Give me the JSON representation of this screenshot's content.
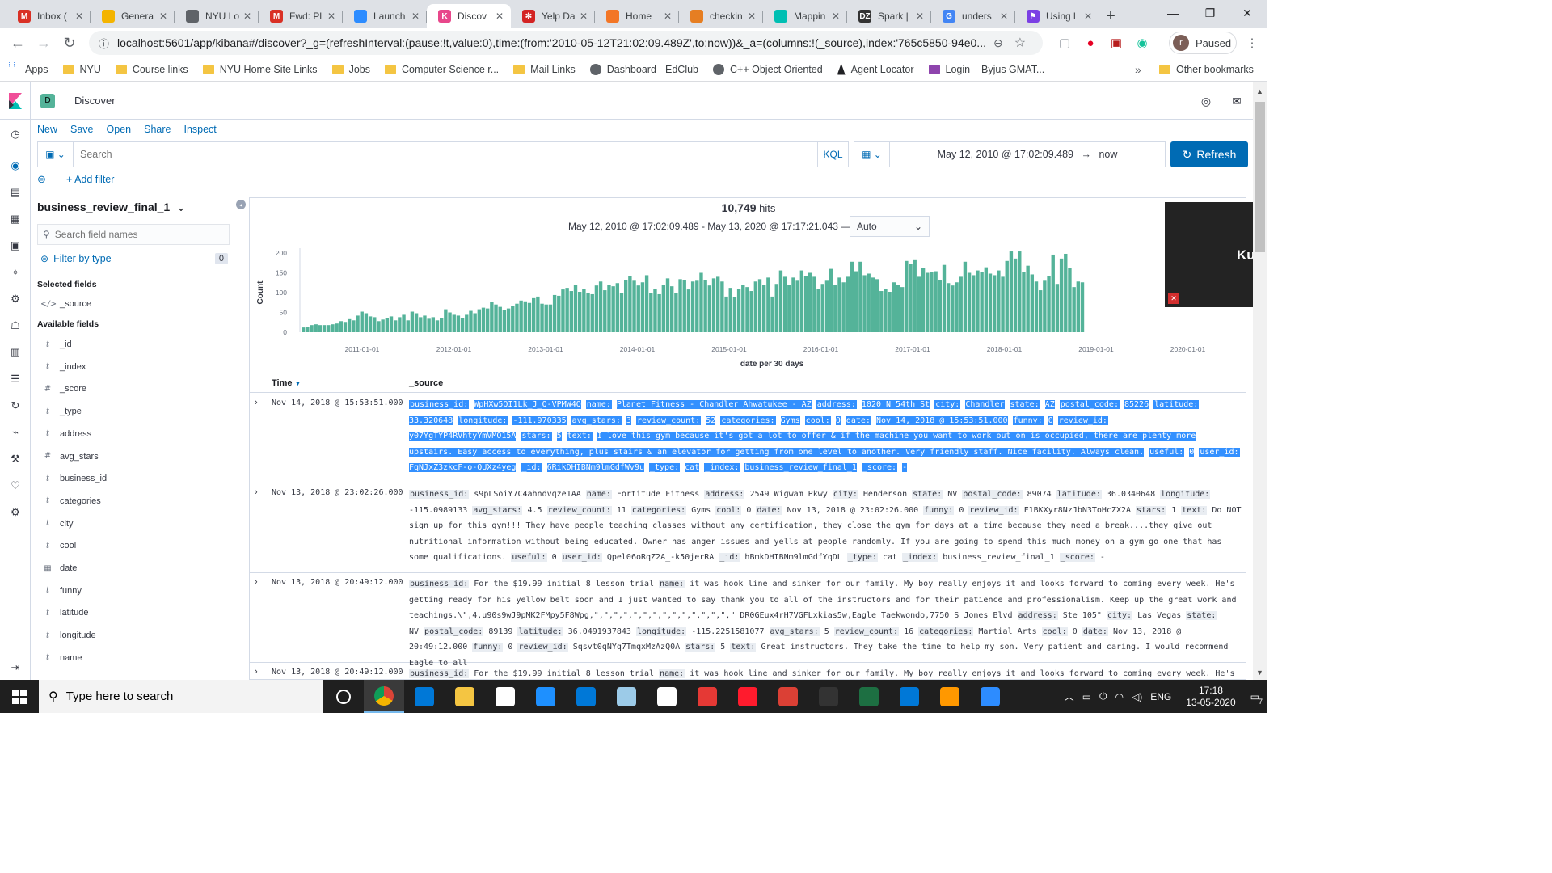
{
  "browser": {
    "tabs": [
      {
        "label": "Inbox (",
        "icon": "gmail-icon",
        "color": "#d93025",
        "glyph": "M"
      },
      {
        "label": "Genera",
        "icon": "slides-icon",
        "color": "#f4b400",
        "glyph": ""
      },
      {
        "label": "NYU Lo",
        "icon": "globe-icon",
        "color": "#5f6368",
        "glyph": ""
      },
      {
        "label": "Fwd: Pl",
        "icon": "gmail-icon",
        "color": "#d93025",
        "glyph": "M"
      },
      {
        "label": "Launch",
        "icon": "zoom-icon",
        "color": "#2d8cff",
        "glyph": ""
      },
      {
        "label": "Discov",
        "icon": "kibana-icon",
        "color": "#e8478b",
        "glyph": "K"
      },
      {
        "label": "Yelp Da",
        "icon": "yelp-icon",
        "color": "#d32323",
        "glyph": "✻"
      },
      {
        "label": "Home",
        "icon": "jupyter-icon",
        "color": "#f37626",
        "glyph": ""
      },
      {
        "label": "checkin",
        "icon": "notebook-icon",
        "color": "#e67e22",
        "glyph": ""
      },
      {
        "label": "Mappin",
        "icon": "elastic-icon",
        "color": "#00bfb3",
        "glyph": ""
      },
      {
        "label": "Spark |",
        "icon": "dzone-icon",
        "color": "#333333",
        "glyph": "DZ"
      },
      {
        "label": "unders",
        "icon": "google-icon",
        "color": "#4285f4",
        "glyph": "G"
      },
      {
        "label": "Using l",
        "icon": "flag-icon",
        "color": "#7b3fe4",
        "glyph": "⚑"
      }
    ],
    "active_tab_index": 5,
    "url": "localhost:5601/app/kibana#/discover?_g=(refreshInterval:(pause:!t,value:0),time:(from:'2010-05-12T21:02:09.489Z',to:now))&_a=(columns:!(_source),index:'765c5850-94e0...",
    "profile_status": "Paused",
    "profile_initial": "r",
    "bookmarks": [
      {
        "label": "Apps",
        "kind": "apps"
      },
      {
        "label": "NYU",
        "kind": "folder"
      },
      {
        "label": "Course links",
        "kind": "folder"
      },
      {
        "label": "NYU Home Site Links",
        "kind": "folder"
      },
      {
        "label": "Jobs",
        "kind": "folder"
      },
      {
        "label": "Computer Science r...",
        "kind": "folder"
      },
      {
        "label": "Mail Links",
        "kind": "folder"
      },
      {
        "label": "Dashboard - EdClub",
        "kind": "dark"
      },
      {
        "label": "C++ Object Oriented",
        "kind": "dark"
      },
      {
        "label": "Agent Locator",
        "kind": "navy"
      },
      {
        "label": "Login – Byjus GMAT...",
        "kind": "purple"
      }
    ],
    "bookmarks_overflow": "»",
    "other_bookmarks": "Other bookmarks"
  },
  "kibana": {
    "app_badge": "D",
    "breadcrumb": "Discover",
    "menu": [
      "New",
      "Save",
      "Open",
      "Share",
      "Inspect"
    ],
    "search_placeholder": "Search",
    "query_language": "KQL",
    "date_range": "May 12, 2010 @ 17:02:09.489",
    "date_to": "now",
    "refresh_label": "Refresh",
    "add_filter": "+ Add filter",
    "index_pattern": "business_review_final_1",
    "field_search_placeholder": "Search field names",
    "filter_by_type": "Filter by type",
    "filter_count": "0",
    "selected_fields_title": "Selected fields",
    "selected_fields": [
      {
        "type": "</>",
        "name": "_source"
      }
    ],
    "available_fields_title": "Available fields",
    "available_fields": [
      {
        "type": "t",
        "name": "_id"
      },
      {
        "type": "t",
        "name": "_index"
      },
      {
        "type": "#",
        "name": "_score"
      },
      {
        "type": "t",
        "name": "_type"
      },
      {
        "type": "t",
        "name": "address"
      },
      {
        "type": "#",
        "name": "avg_stars"
      },
      {
        "type": "t",
        "name": "business_id"
      },
      {
        "type": "t",
        "name": "categories"
      },
      {
        "type": "t",
        "name": "city"
      },
      {
        "type": "t",
        "name": "cool"
      },
      {
        "type": "▦",
        "name": "date"
      },
      {
        "type": "t",
        "name": "funny"
      },
      {
        "type": "t",
        "name": "latitude"
      },
      {
        "type": "t",
        "name": "longitude"
      },
      {
        "type": "t",
        "name": "name"
      }
    ],
    "hits_count": "10,749",
    "hits_label": "hits",
    "time_range_text": "May 12, 2010 @ 17:02:09.489 - May 13, 2020 @ 17:17:21.043 —",
    "interval": "Auto",
    "table_headers": {
      "time": "Time",
      "source": "_source"
    },
    "docs": [
      {
        "time": "Nov 14, 2018 @ 15:53:51.000",
        "selected": true,
        "fields": [
          [
            "business_id:",
            "WpHXw5QI1Lk_J_Q-VPMW4Q"
          ],
          [
            "name:",
            "Planet Fitness - Chandler Ahwatukee - AZ"
          ],
          [
            "address:",
            "1020 N 54th St"
          ],
          [
            "city:",
            "Chandler"
          ],
          [
            "state:",
            "AZ"
          ],
          [
            "postal_code:",
            "85226"
          ],
          [
            "latitude:",
            "33.320648"
          ],
          [
            "longitude:",
            "-111.970335"
          ],
          [
            "avg_stars:",
            "3"
          ],
          [
            "review_count:",
            "52"
          ],
          [
            "categories:",
            "Gyms"
          ],
          [
            "cool:",
            "0"
          ],
          [
            "date:",
            "Nov 14, 2018 @ 15:53:51.000"
          ],
          [
            "funny:",
            "0"
          ],
          [
            "review_id:",
            "y07YgTYP4RVhtyYmVMO15A"
          ],
          [
            "stars:",
            "5"
          ],
          [
            "text:",
            "I love this gym because it's got a lot to offer & if the machine you want to work out on is occupied, there are plenty more upstairs. Easy access to everything, plus stairs & an elevator for getting from one level to another. Very friendly staff. Nice facility. Always clean."
          ],
          [
            "useful:",
            "0"
          ],
          [
            "user_id:",
            "FqNJxZ3zkcF-o-QUXz4yeg"
          ],
          [
            "_id:",
            "6RikDHIBNm9lmGdfWv9u"
          ],
          [
            "_type:",
            "cat"
          ],
          [
            "_index:",
            "business_review_final_1"
          ],
          [
            "_score:",
            " -"
          ]
        ]
      },
      {
        "time": "Nov 13, 2018 @ 23:02:26.000",
        "selected": false,
        "fields": [
          [
            "business_id:",
            "s9pLSoiY7C4ahndvqze1AA"
          ],
          [
            "name:",
            "Fortitude Fitness"
          ],
          [
            "address:",
            "2549 Wigwam Pkwy"
          ],
          [
            "city:",
            "Henderson"
          ],
          [
            "state:",
            "NV"
          ],
          [
            "postal_code:",
            "89074"
          ],
          [
            "latitude:",
            "36.0340648"
          ],
          [
            "longitude:",
            "-115.0989133"
          ],
          [
            "avg_stars:",
            "4.5"
          ],
          [
            "review_count:",
            "11"
          ],
          [
            "categories:",
            "Gyms"
          ],
          [
            "cool:",
            "0"
          ],
          [
            "date:",
            "Nov 13, 2018 @ 23:02:26.000"
          ],
          [
            "funny:",
            "0"
          ],
          [
            "review_id:",
            "F1BKXyr8NzJbN3ToHcZX2A"
          ],
          [
            "stars:",
            "1"
          ],
          [
            "text:",
            "Do NOT sign up for this gym!!! They have people teaching classes without any certification, they close the gym for days at a time because they need a break....they give out nutritional information without being educated. Owner has anger issues and yells at people randomly. If you are going to spend this much money on a gym go one that has some qualifications."
          ],
          [
            "useful:",
            "0"
          ],
          [
            "user_id:",
            "Qpel06oRqZ2A_-k50jerRA"
          ],
          [
            "_id:",
            "hBmkDHIBNm9lmGdfYqDL"
          ],
          [
            "_type:",
            "cat"
          ],
          [
            "_index:",
            "business_review_final_1"
          ],
          [
            "_score:",
            " -"
          ]
        ]
      },
      {
        "time": "Nov 13, 2018 @ 20:49:12.000",
        "selected": false,
        "fields": [
          [
            "business_id:",
            "For the $19.99 initial 8 lesson trial"
          ],
          [
            "name:",
            "it was hook line and sinker for our family. My boy really enjoys it and looks forward to coming every week. He's getting ready for his yellow belt soon and I just wanted to say thank you to all of the instructors and for their patience and professionalism. Keep up the great work and teachings.\\\",4,u90s9wJ9pMK2FMpy5F8Wpg,\",\",\",\",\",\",\",\",\",\",\",\",\",\",\" DR0GEux4rH7VGFLxkias5w,Eagle Taekwondo,7750 S Jones Blvd"
          ],
          [
            "address:",
            "Ste 105\""
          ],
          [
            "city:",
            "Las Vegas"
          ],
          [
            "state:",
            "NV"
          ],
          [
            "postal_code:",
            "89139"
          ],
          [
            "latitude:",
            "36.0491937843"
          ],
          [
            "longitude:",
            "-115.2251581077"
          ],
          [
            "avg_stars:",
            "5"
          ],
          [
            "review_count:",
            "16"
          ],
          [
            "categories:",
            "Martial Arts"
          ],
          [
            "cool:",
            "0"
          ],
          [
            "date:",
            "Nov 13, 2018 @ 20:49:12.000"
          ],
          [
            "funny:",
            "0"
          ],
          [
            "review_id:",
            "Sqsvt0qNYq7TmqxMzAzQ0A"
          ],
          [
            "stars:",
            "5"
          ],
          [
            "text:",
            "Great instructors. They take the time to help my son. Very patient and caring. I would recommend Eagle to all"
          ]
        ]
      },
      {
        "time": "Nov 13, 2018 @ 20:49:12.000",
        "selected": false,
        "fields": [
          [
            "business_id:",
            "For the $19.99 initial 8 lesson trial"
          ],
          [
            "name:",
            "it was hook line and sinker for our family. My boy really enjoys it and looks forward to coming every week. He's"
          ]
        ]
      }
    ]
  },
  "chart_data": {
    "type": "bar",
    "title": "",
    "xlabel": "date per 30 days",
    "ylabel": "Count",
    "ylim": [
      0,
      200
    ],
    "yticks": [
      0,
      50,
      100,
      150,
      200
    ],
    "xticks": [
      "2011-01-01",
      "2012-01-01",
      "2013-01-01",
      "2014-01-01",
      "2015-01-01",
      "2016-01-01",
      "2017-01-01",
      "2018-01-01",
      "2019-01-01",
      "2020-01-01"
    ],
    "bar_color": "#54b399",
    "x_start": "2010-05",
    "x_step": "30 days",
    "values": [
      12,
      14,
      18,
      20,
      18,
      18,
      18,
      20,
      22,
      28,
      26,
      33,
      30,
      42,
      52,
      48,
      40,
      38,
      28,
      32,
      36,
      40,
      30,
      38,
      44,
      30,
      52,
      48,
      38,
      42,
      34,
      38,
      30,
      36,
      58,
      50,
      44,
      42,
      36,
      44,
      54,
      48,
      58,
      62,
      60,
      76,
      70,
      64,
      56,
      60,
      66,
      72,
      80,
      78,
      74,
      86,
      90,
      72,
      70,
      70,
      94,
      92,
      108,
      112,
      104,
      120,
      102,
      110,
      100,
      96,
      118,
      128,
      106,
      120,
      116,
      124,
      100,
      132,
      142,
      130,
      118,
      126,
      144,
      100,
      110,
      96,
      120,
      136,
      116,
      100,
      134,
      132,
      108,
      128,
      130,
      150,
      132,
      118,
      136,
      140,
      128,
      90,
      112,
      88,
      110,
      120,
      114,
      104,
      128,
      134,
      120,
      138,
      90,
      122,
      156,
      140,
      120,
      138,
      130,
      156,
      142,
      150,
      140,
      110,
      122,
      130,
      160,
      120,
      138,
      126,
      140,
      178,
      154,
      178,
      144,
      148,
      138,
      134,
      104,
      110,
      102,
      126,
      120,
      114,
      180,
      172,
      182,
      140,
      162,
      150,
      152,
      154,
      132,
      170,
      124,
      118,
      126,
      140,
      178,
      150,
      144,
      156,
      152,
      164,
      148,
      144,
      156,
      140,
      180,
      204,
      186,
      204,
      152,
      168,
      146,
      128,
      106,
      130,
      142,
      196,
      122,
      186,
      198,
      162,
      114,
      128,
      126
    ]
  },
  "overlay": {
    "participant_name": "Kushal S",
    "muted": true
  },
  "taskbar": {
    "search_placeholder": "Type here to search",
    "apps": [
      {
        "icon": "task-view-icon",
        "color": "#ffffff"
      },
      {
        "icon": "chrome-icon",
        "color": "#4285f4"
      },
      {
        "icon": "edge-icon",
        "color": "#0078d7"
      },
      {
        "icon": "file-explorer-icon",
        "color": "#f4c542"
      },
      {
        "icon": "store-icon",
        "color": "#ffffff"
      },
      {
        "icon": "safari-icon",
        "color": "#1e90ff"
      },
      {
        "icon": "mail-icon",
        "color": "#0078d7"
      },
      {
        "icon": "notepad-icon",
        "color": "#9ccbe8"
      },
      {
        "icon": "google-icon",
        "color": "#ffffff"
      },
      {
        "icon": "app-red-icon",
        "color": "#e53935"
      },
      {
        "icon": "opera-icon",
        "color": "#ff1b2d"
      },
      {
        "icon": "todoist-icon",
        "color": "#db4035"
      },
      {
        "icon": "terminal-icon",
        "color": "#333333"
      },
      {
        "icon": "excel-icon",
        "color": "#1d6f42"
      },
      {
        "icon": "photos-icon",
        "color": "#0078d7"
      },
      {
        "icon": "sublime-icon",
        "color": "#ff9800"
      },
      {
        "icon": "zoom-icon",
        "color": "#2d8cff"
      }
    ],
    "language": "ENG",
    "time": "17:18",
    "date": "13-05-2020",
    "notification_count": "7"
  }
}
